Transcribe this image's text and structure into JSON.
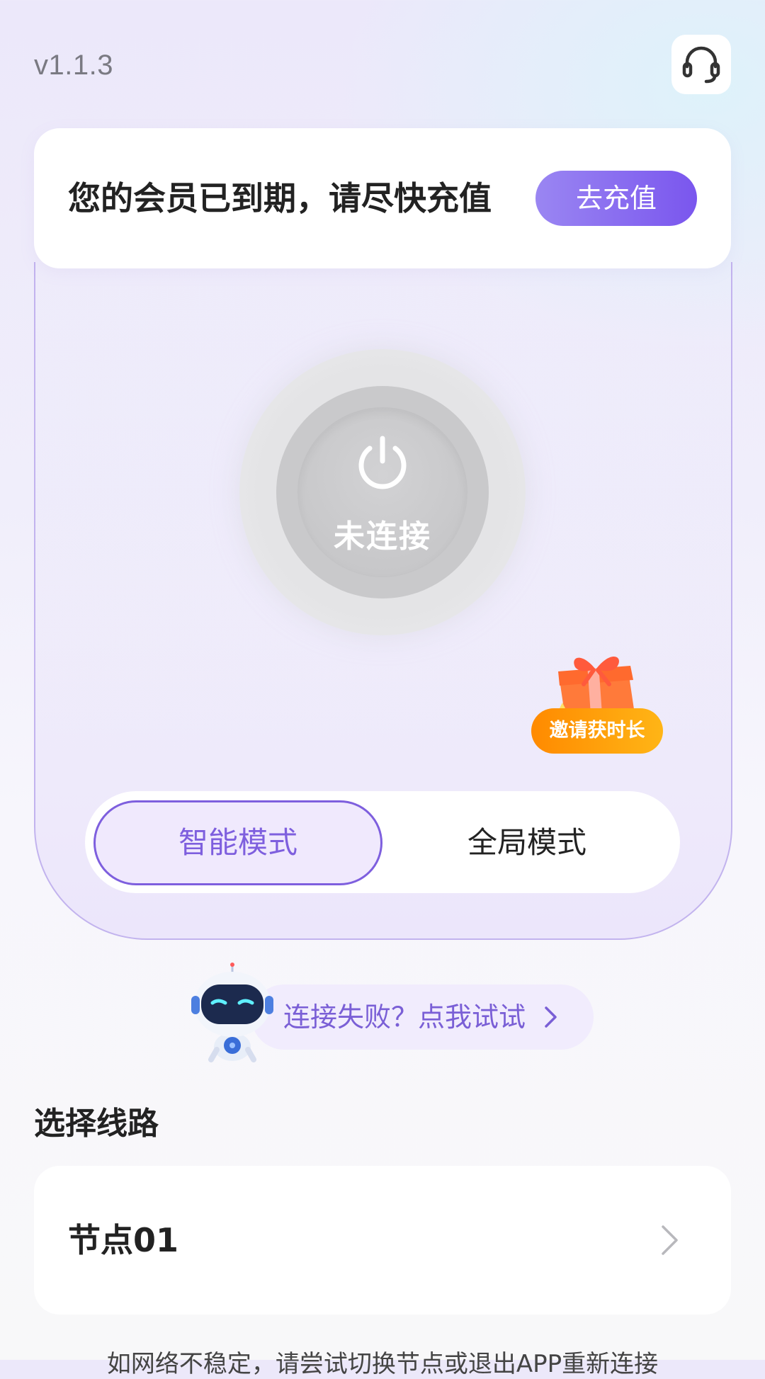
{
  "header": {
    "version": "v1.1.3",
    "support_icon": "headset-icon"
  },
  "membership": {
    "message": "您的会员已到期，请尽快充值",
    "recharge_label": "去充值"
  },
  "connection": {
    "status_label": "未连接",
    "power_icon": "power-icon"
  },
  "invite": {
    "label": "邀请获时长",
    "icon": "gift-icon"
  },
  "modes": {
    "smart_label": "智能模式",
    "global_label": "全局模式",
    "selected": "smart"
  },
  "help": {
    "text": "连接失败？点我试试",
    "icon": "robot-icon"
  },
  "route": {
    "section_title": "选择线路",
    "node_name": "节点01"
  },
  "footer": {
    "tip": "如网络不稳定，请尝试切换节点或退出APP重新连接"
  },
  "colors": {
    "accent": "#7e5fde",
    "recharge_gradient_start": "#9a86f2",
    "recharge_gradient_end": "#7a56ee",
    "invite_orange": "#ff8a00"
  }
}
